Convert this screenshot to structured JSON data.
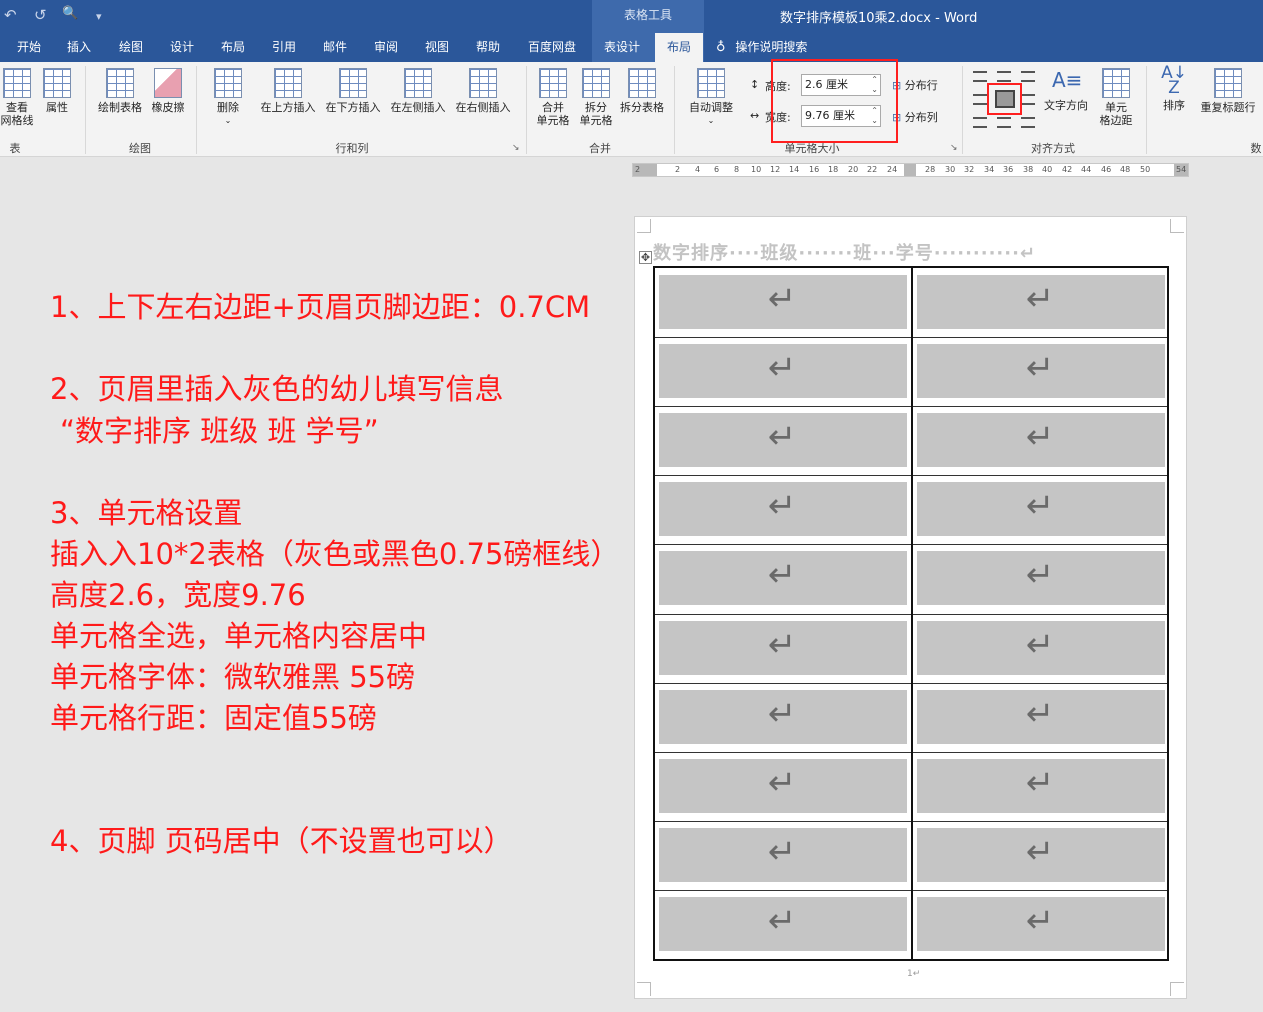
{
  "titlebar": {
    "qat_undo": "↶",
    "qat_redo": "↺",
    "qat_preview": "🔍",
    "qat_more": "▾",
    "context_group": "表格工具",
    "document_title": "数字排序模板10乘2.docx  -  Word"
  },
  "tabs": [
    {
      "label": "开始"
    },
    {
      "label": "插入"
    },
    {
      "label": "绘图"
    },
    {
      "label": "设计"
    },
    {
      "label": "布局"
    },
    {
      "label": "引用"
    },
    {
      "label": "邮件"
    },
    {
      "label": "审阅"
    },
    {
      "label": "视图"
    },
    {
      "label": "帮助"
    },
    {
      "label": "百度网盘"
    },
    {
      "label": "表设计"
    },
    {
      "label": "布局"
    }
  ],
  "search_tab": "操作说明搜索",
  "ribbon": {
    "table": {
      "view_gridlines": "查看\n网格线",
      "properties": "属性",
      "group": "表"
    },
    "draw": {
      "draw_table": "绘制表格",
      "eraser": "橡皮擦",
      "group": "绘图"
    },
    "rows_cols": {
      "delete": "删除",
      "insert_above": "在上方插入",
      "insert_below": "在下方插入",
      "insert_left": "在左侧插入",
      "insert_right": "在右侧插入",
      "group": "行和列"
    },
    "merge": {
      "merge_cells": "合并\n单元格",
      "split_cells": "拆分\n单元格",
      "split_table": "拆分表格",
      "group": "合并"
    },
    "cell_size": {
      "autofit": "自动调整",
      "height_label": "高度:",
      "height_value": "2.6 厘米",
      "width_label": "宽度:",
      "width_value": "9.76 厘米",
      "distribute_rows": "分布行",
      "distribute_cols": "分布列",
      "group": "单元格大小"
    },
    "alignment": {
      "text_direction": "文字方向",
      "cell_margins": "单元\n格边距",
      "group": "对齐方式"
    },
    "data": {
      "sort": "排序",
      "repeat_header": "重复标题行",
      "group": "数"
    }
  },
  "ruler": {
    "ticks": [
      "2",
      "2",
      "4",
      "6",
      "8",
      "10",
      "12",
      "14",
      "16",
      "18",
      "20",
      "22",
      "24",
      "28",
      "30",
      "32",
      "34",
      "36",
      "38",
      "40",
      "42",
      "44",
      "46",
      "48",
      "50",
      "54"
    ]
  },
  "instructions": [
    "1、上下左右边距+页眉页脚边距：0.7CM",
    "2、页眉里插入灰色的幼儿填写信息",
    "“数字排序 班级 班 学号”",
    "3、单元格设置",
    "插入入10*2表格（灰色或黑色0.75磅框线）",
    "高度2.6，宽度9.76",
    "单元格全选，单元格内容居中",
    "单元格字体：微软雅黑 55磅",
    "单元格行距：固定值55磅",
    "4、页脚 页码居中（不设置也可以）"
  ],
  "page": {
    "header_text": "数字排序····班级·······班···学号···········↵",
    "cell_mark": "↵",
    "rows": 10,
    "cols": 2,
    "page_number": "1↵",
    "move_handle": "✥"
  },
  "colors": {
    "ribbon_blue": "#2b579a",
    "annotation_red": "#ff1a1a",
    "cell_gray": "#c5c5c5"
  }
}
